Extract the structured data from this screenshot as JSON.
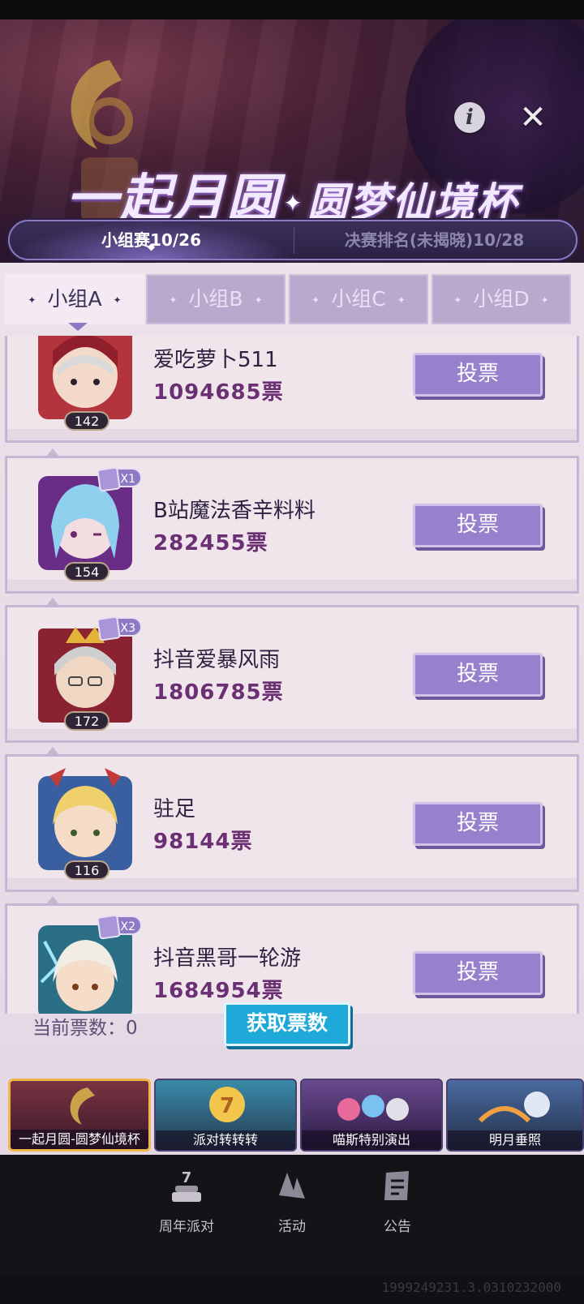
{
  "header": {
    "title_part1": "一起月圆",
    "title_part2": "圆梦仙境杯",
    "info_label": "i",
    "close_label": "✕"
  },
  "stages": [
    {
      "label": "小组赛10/26",
      "active": true
    },
    {
      "label": "决赛排名(未揭晓)10/28",
      "active": false
    }
  ],
  "groups": [
    {
      "label": "小组A",
      "active": true
    },
    {
      "label": "小组B",
      "active": false
    },
    {
      "label": "小组C",
      "active": false
    },
    {
      "label": "小组D",
      "active": false
    }
  ],
  "entries": [
    {
      "name": "爱吃萝卜511",
      "votes": "1094685票",
      "level": "142",
      "multiplier": "",
      "vote_label": "投票",
      "avatar": "red-hood-girl-icon",
      "colors": {
        "frame": "#b3343c",
        "hair": "#d9d9dc"
      }
    },
    {
      "name": "B站魔法香辛料料",
      "votes": "282455票",
      "level": "154",
      "multiplier": "X1",
      "vote_label": "投票",
      "avatar": "blue-hair-girl-icon",
      "colors": {
        "frame": "#6a2d87",
        "hair": "#8fd0ee"
      }
    },
    {
      "name": "抖音爱暴风雨",
      "votes": "1806785票",
      "level": "172",
      "multiplier": "X3",
      "vote_label": "投票",
      "avatar": "crowned-elder-icon",
      "colors": {
        "frame": "#8a2231",
        "hair": "#cfcfcf"
      }
    },
    {
      "name": "驻足",
      "votes": "98144票",
      "level": "116",
      "multiplier": "",
      "vote_label": "投票",
      "avatar": "blonde-girl-icon",
      "colors": {
        "frame": "#c23a3a",
        "hair": "#f0cf6d"
      }
    },
    {
      "name": "抖音黑哥一轮游",
      "votes": "1684954票",
      "level": "",
      "multiplier": "X2",
      "vote_label": "投票",
      "avatar": "white-hair-mage-icon",
      "colors": {
        "frame": "#2b6f86",
        "hair": "#f1ede4"
      }
    }
  ],
  "footer": {
    "current_votes_label": "当前票数：",
    "current_votes_value": "0",
    "get_votes_label": "获取票数"
  },
  "events": [
    {
      "label": "一起月圆-圆梦仙境杯",
      "active": true,
      "color": "#6a2a3a"
    },
    {
      "label": "派对转转转",
      "active": false,
      "color": "#2f6d8a"
    },
    {
      "label": "喵斯特别演出",
      "active": false,
      "color": "#5a3a78"
    },
    {
      "label": "明月垂照",
      "active": false,
      "color": "#3b5c86"
    }
  ],
  "nav": [
    {
      "label": "周年派对",
      "icon": "anniversary-cake-icon"
    },
    {
      "label": "活动",
      "icon": "activity-icon"
    },
    {
      "label": "公告",
      "icon": "notice-icon"
    }
  ],
  "build_string": "1999249231.3.0310232000",
  "colors": {
    "accent_purple": "#9780cc",
    "get_button_blue": "#1fa9d9",
    "votes_text": "#6b2f73"
  }
}
